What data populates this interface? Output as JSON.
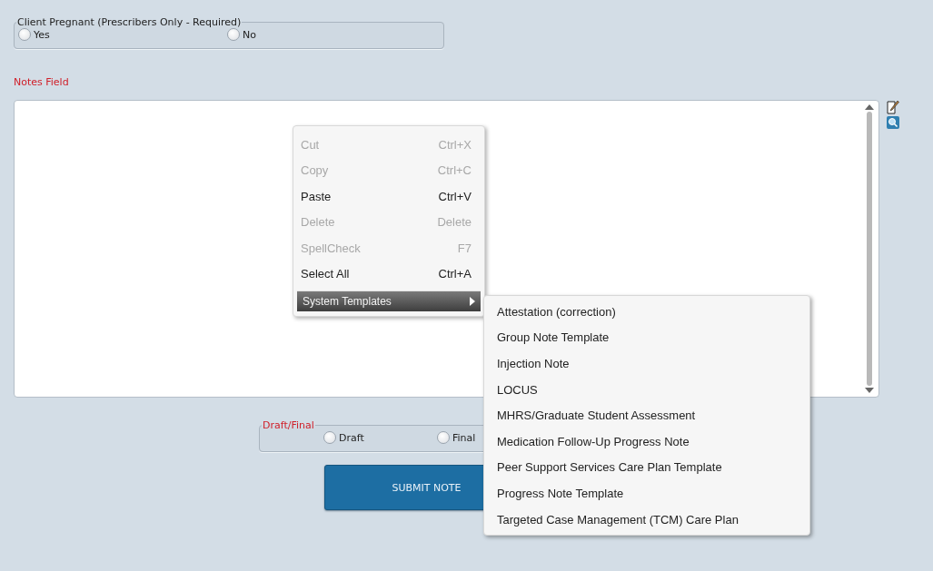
{
  "pregnant_group": {
    "legend": "Client Pregnant (Prescribers Only - Required)",
    "options": [
      {
        "label": "Yes",
        "selected": false
      },
      {
        "label": "No",
        "selected": false
      }
    ]
  },
  "notes": {
    "label": "Notes Field"
  },
  "context_menu": {
    "items": [
      {
        "label": "Cut",
        "shortcut": "Ctrl+X",
        "disabled": true,
        "kind": "command"
      },
      {
        "label": "Copy",
        "shortcut": "Ctrl+C",
        "disabled": true,
        "kind": "command"
      },
      {
        "label": "Paste",
        "shortcut": "Ctrl+V",
        "disabled": false,
        "kind": "command"
      },
      {
        "label": "Delete",
        "shortcut": "Delete",
        "disabled": true,
        "kind": "command"
      },
      {
        "label": "SpellCheck",
        "shortcut": "F7",
        "disabled": true,
        "kind": "command"
      },
      {
        "label": "Select All",
        "shortcut": "Ctrl+A",
        "disabled": false,
        "kind": "command"
      },
      {
        "label": "System Templates",
        "kind": "submenu",
        "selected": true
      }
    ]
  },
  "submenu": {
    "items": [
      "Attestation (correction)",
      "Group Note Template",
      "Injection Note",
      "LOCUS",
      "MHRS/Graduate Student Assessment",
      "Medication Follow-Up Progress Note",
      "Peer Support Services Care Plan Template",
      "Progress Note Template",
      "Targeted Case Management (TCM) Care Plan"
    ]
  },
  "status_group": {
    "legend": "Draft/Final",
    "options": [
      {
        "label": "Draft",
        "selected": false
      },
      {
        "label": "Final",
        "selected": false
      }
    ]
  },
  "submit_button": {
    "label": "SUBMIT NOTE"
  }
}
